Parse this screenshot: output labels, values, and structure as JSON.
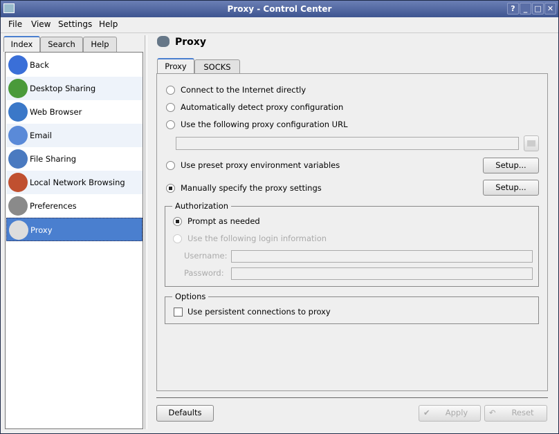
{
  "window": {
    "title": "Proxy - Control Center",
    "buttons": [
      "?",
      "_",
      "□",
      "✕"
    ]
  },
  "menu": [
    "File",
    "View",
    "Settings",
    "Help"
  ],
  "sidebar": {
    "tabs": [
      "Index",
      "Search",
      "Help"
    ],
    "items": [
      {
        "label": "Back",
        "icon": "back-arrow-icon",
        "color": "#3a6fd8"
      },
      {
        "label": "Desktop Sharing",
        "icon": "desktop-sharing-icon",
        "color": "#4a9a3a"
      },
      {
        "label": "Web Browser",
        "icon": "web-browser-icon",
        "color": "#3b78c8"
      },
      {
        "label": "Email",
        "icon": "email-icon",
        "color": "#5a8ad8"
      },
      {
        "label": "File Sharing",
        "icon": "file-sharing-icon",
        "color": "#4a7ac0"
      },
      {
        "label": "Local Network Browsing",
        "icon": "network-browsing-icon",
        "color": "#c05030"
      },
      {
        "label": "Preferences",
        "icon": "preferences-icon",
        "color": "#8a8a8a"
      },
      {
        "label": "Proxy",
        "icon": "proxy-icon",
        "color": "#dddddd"
      }
    ],
    "selected": "Proxy"
  },
  "main": {
    "title": "Proxy",
    "tabs": [
      "Proxy",
      "SOCKS"
    ],
    "options": [
      "Connect to the Internet directly",
      "Automatically detect proxy configuration",
      "Use the following proxy configuration URL",
      "Use preset proxy environment variables",
      "Manually specify the proxy settings"
    ],
    "selected_option": 4,
    "url_value": "",
    "setup_label": "Setup...",
    "auth": {
      "title": "Authorization",
      "options": [
        "Prompt as needed",
        "Use the following login information"
      ],
      "username_label": "Username:",
      "password_label": "Password:",
      "username": "",
      "password": ""
    },
    "opts": {
      "title": "Options",
      "persistent": "Use persistent connections to proxy",
      "checked": false
    }
  },
  "footer": {
    "defaults": "Defaults",
    "apply": "Apply",
    "reset": "Reset"
  }
}
